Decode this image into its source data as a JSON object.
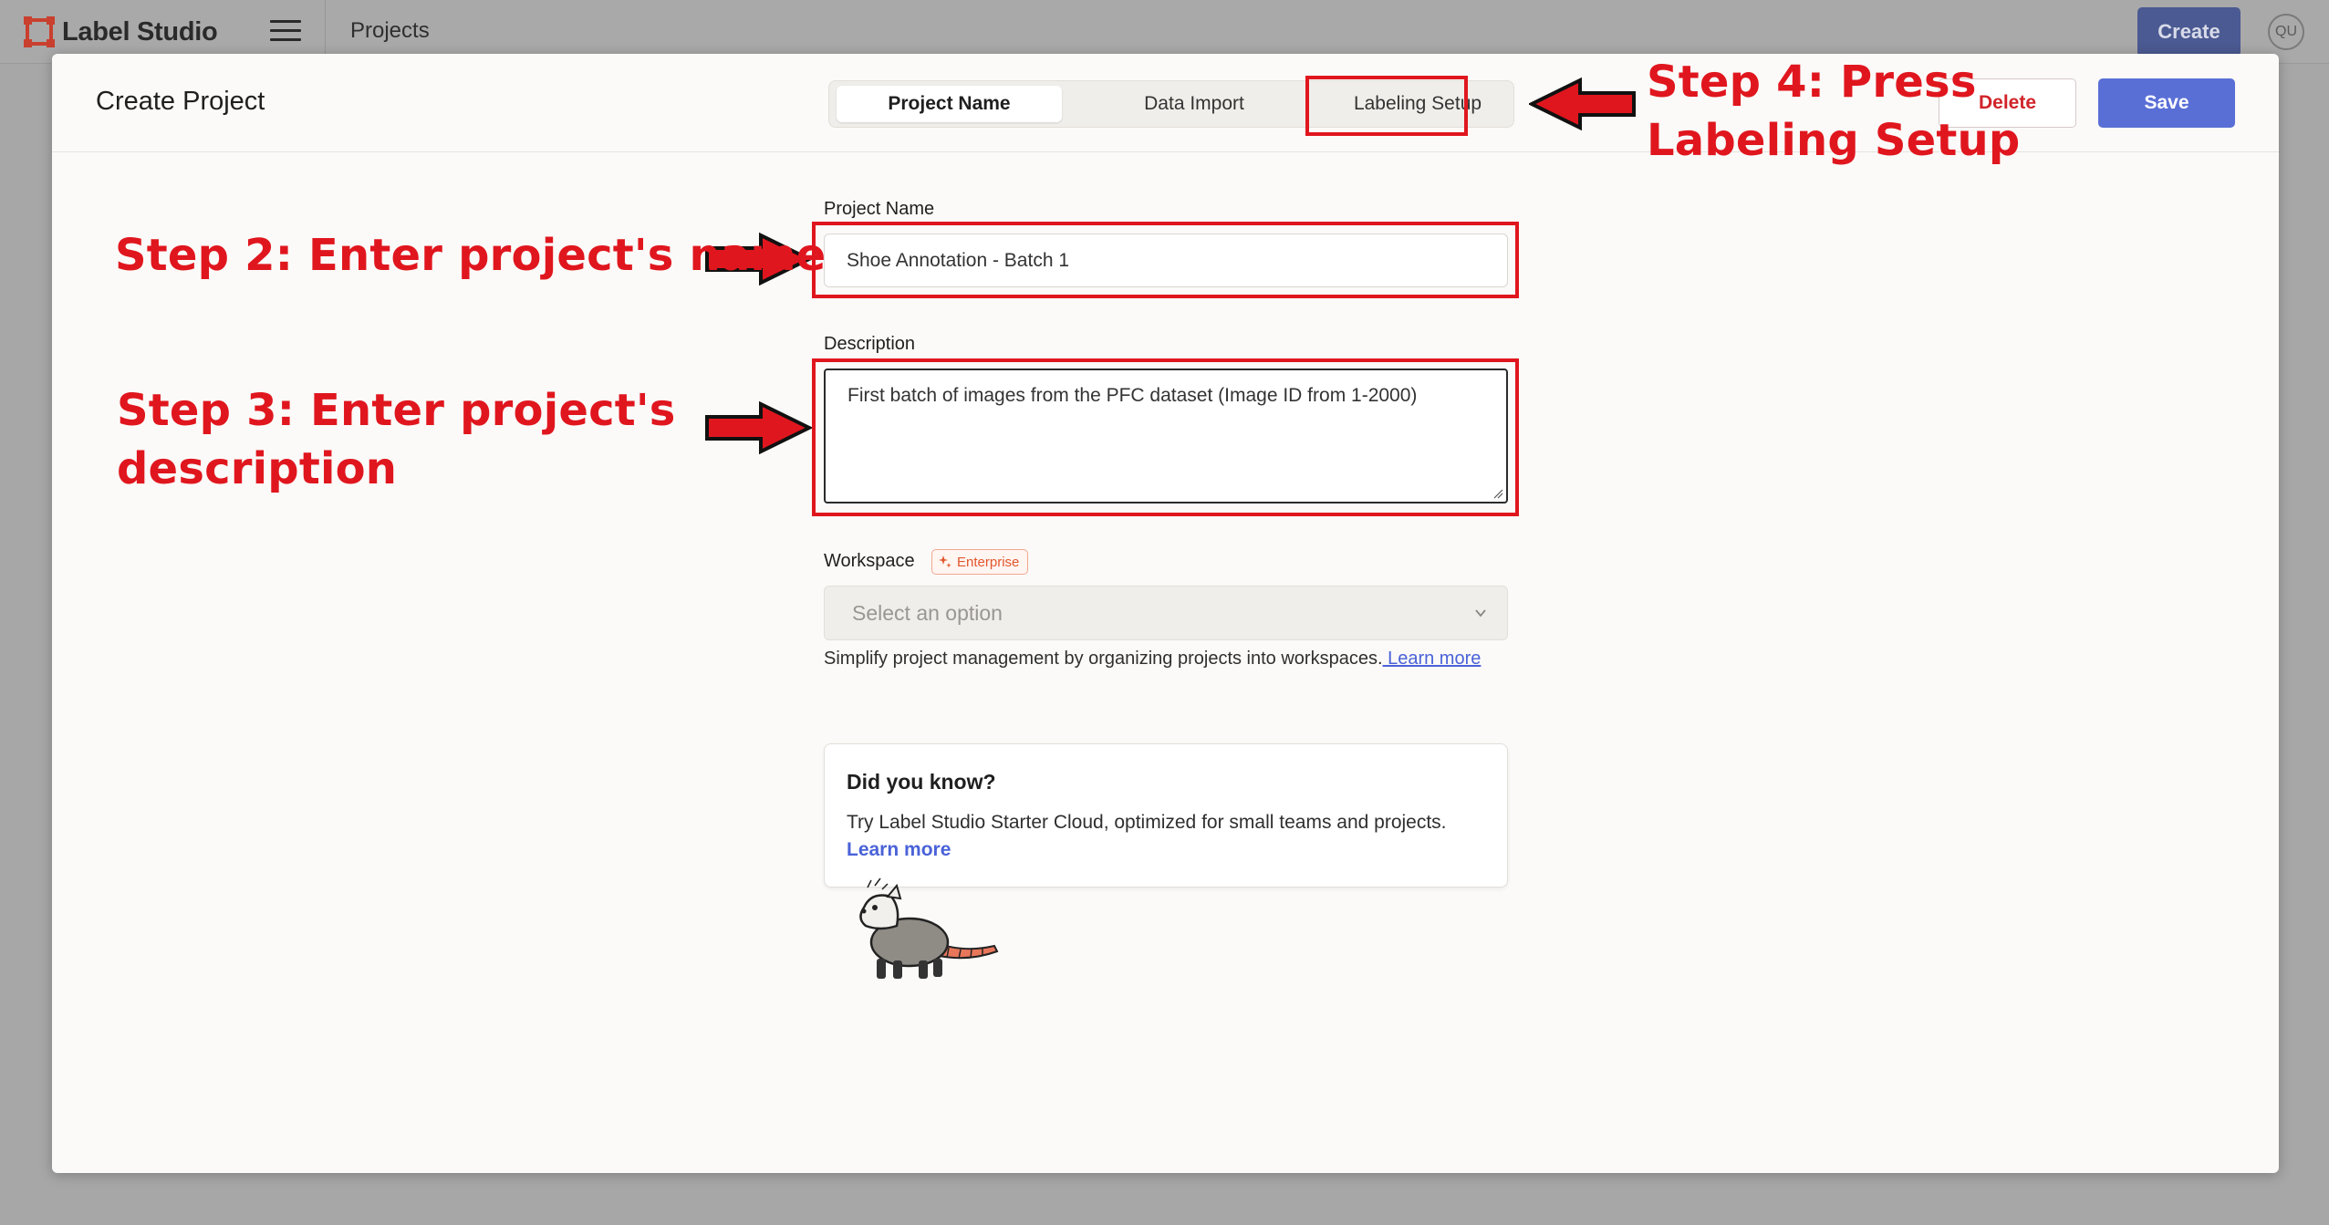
{
  "topbar": {
    "app_name": "Label Studio",
    "breadcrumb": "Projects",
    "create_label": "Create",
    "avatar_initials": "QU"
  },
  "modal": {
    "title": "Create Project",
    "tabs": [
      {
        "label": "Project Name",
        "active": true
      },
      {
        "label": "Data Import",
        "active": false
      },
      {
        "label": "Labeling Setup",
        "active": false
      }
    ],
    "delete_label": "Delete",
    "save_label": "Save"
  },
  "form": {
    "project_name_label": "Project Name",
    "project_name_value": "Shoe Annotation - Batch 1",
    "description_label": "Description",
    "description_value": "First batch of images from the PFC dataset (Image ID from 1-2000)",
    "workspace_label": "Workspace",
    "workspace_badge": "Enterprise",
    "workspace_placeholder": "Select an option",
    "workspace_help": "Simplify project management by organizing projects into workspaces.",
    "workspace_help_link": " Learn more"
  },
  "card": {
    "title": "Did you know?",
    "body": "Try Label Studio Starter Cloud, optimized for small teams and projects.",
    "link": "Learn more"
  },
  "annotations": {
    "step2": "Step 2: Enter project's name",
    "step3_line1": "Step 3: Enter project's",
    "step3_line2": "description",
    "step4_line1": "Step 4: Press",
    "step4_line2": "Labeling Setup"
  },
  "colors": {
    "accent": "#5a6fd6",
    "annotation_red": "#e0161e",
    "delete_red": "#d0242a",
    "enterprise_orange": "#e2562c"
  }
}
